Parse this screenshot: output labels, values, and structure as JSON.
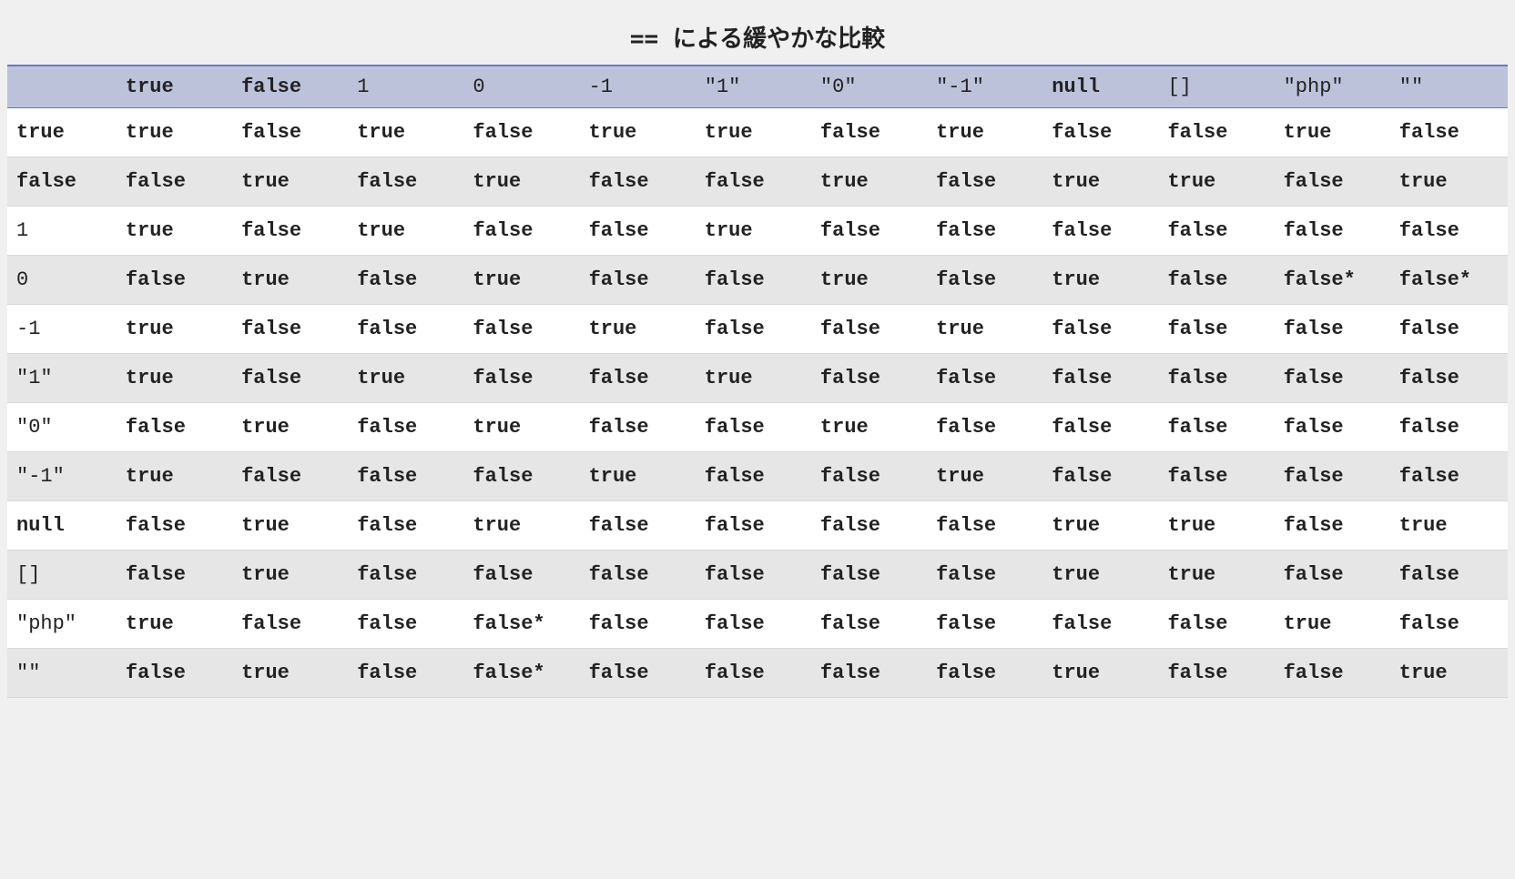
{
  "caption": "== による緩やかな比較",
  "columns": [
    {
      "label": "true",
      "bold": true
    },
    {
      "label": "false",
      "bold": true
    },
    {
      "label": "1",
      "bold": false
    },
    {
      "label": "0",
      "bold": false
    },
    {
      "label": "-1",
      "bold": false
    },
    {
      "label": "\"1\"",
      "bold": false
    },
    {
      "label": "\"0\"",
      "bold": false
    },
    {
      "label": "\"-1\"",
      "bold": false
    },
    {
      "label": "null",
      "bold": true
    },
    {
      "label": "[]",
      "bold": false
    },
    {
      "label": "\"php\"",
      "bold": false
    },
    {
      "label": "\"\"",
      "bold": false
    }
  ],
  "rows": [
    {
      "label": "true",
      "bold": true,
      "cells": [
        "true",
        "false",
        "true",
        "false",
        "true",
        "true",
        "false",
        "true",
        "false",
        "false",
        "true",
        "false"
      ]
    },
    {
      "label": "false",
      "bold": true,
      "cells": [
        "false",
        "true",
        "false",
        "true",
        "false",
        "false",
        "true",
        "false",
        "true",
        "true",
        "false",
        "true"
      ]
    },
    {
      "label": "1",
      "bold": false,
      "cells": [
        "true",
        "false",
        "true",
        "false",
        "false",
        "true",
        "false",
        "false",
        "false",
        "false",
        "false",
        "false"
      ]
    },
    {
      "label": "0",
      "bold": false,
      "cells": [
        "false",
        "true",
        "false",
        "true",
        "false",
        "false",
        "true",
        "false",
        "true",
        "false",
        "false*",
        "false*"
      ]
    },
    {
      "label": "-1",
      "bold": false,
      "cells": [
        "true",
        "false",
        "false",
        "false",
        "true",
        "false",
        "false",
        "true",
        "false",
        "false",
        "false",
        "false"
      ]
    },
    {
      "label": "\"1\"",
      "bold": false,
      "cells": [
        "true",
        "false",
        "true",
        "false",
        "false",
        "true",
        "false",
        "false",
        "false",
        "false",
        "false",
        "false"
      ]
    },
    {
      "label": "\"0\"",
      "bold": false,
      "cells": [
        "false",
        "true",
        "false",
        "true",
        "false",
        "false",
        "true",
        "false",
        "false",
        "false",
        "false",
        "false"
      ]
    },
    {
      "label": "\"-1\"",
      "bold": false,
      "cells": [
        "true",
        "false",
        "false",
        "false",
        "true",
        "false",
        "false",
        "true",
        "false",
        "false",
        "false",
        "false"
      ]
    },
    {
      "label": "null",
      "bold": true,
      "cells": [
        "false",
        "true",
        "false",
        "true",
        "false",
        "false",
        "false",
        "false",
        "true",
        "true",
        "false",
        "true"
      ]
    },
    {
      "label": "[]",
      "bold": false,
      "cells": [
        "false",
        "true",
        "false",
        "false",
        "false",
        "false",
        "false",
        "false",
        "true",
        "true",
        "false",
        "false"
      ]
    },
    {
      "label": "\"php\"",
      "bold": false,
      "cells": [
        "true",
        "false",
        "false",
        "false*",
        "false",
        "false",
        "false",
        "false",
        "false",
        "false",
        "true",
        "false"
      ]
    },
    {
      "label": "\"\"",
      "bold": false,
      "cells": [
        "false",
        "true",
        "false",
        "false*",
        "false",
        "false",
        "false",
        "false",
        "true",
        "false",
        "false",
        "true"
      ]
    }
  ]
}
